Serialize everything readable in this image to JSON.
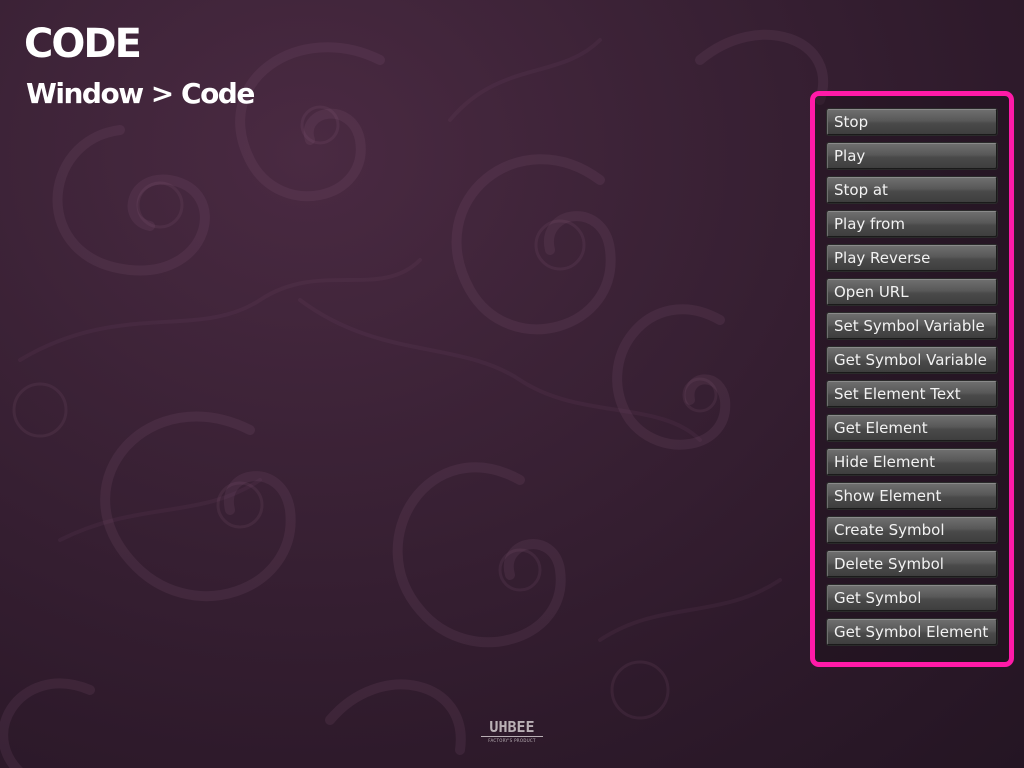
{
  "slide": {
    "title": "CODE",
    "subtitle": "Window > Code"
  },
  "code_panel": {
    "buttons": [
      {
        "label": "Stop"
      },
      {
        "label": "Play"
      },
      {
        "label": "Stop at"
      },
      {
        "label": "Play from"
      },
      {
        "label": "Play Reverse"
      },
      {
        "label": "Open URL"
      },
      {
        "label": "Set Symbol Variable"
      },
      {
        "label": "Get Symbol Variable"
      },
      {
        "label": "Set Element Text"
      },
      {
        "label": "Get Element"
      },
      {
        "label": "Hide Element"
      },
      {
        "label": "Show Element"
      },
      {
        "label": "Create Symbol"
      },
      {
        "label": "Delete Symbol"
      },
      {
        "label": "Get Symbol"
      },
      {
        "label": "Get Symbol Element"
      }
    ]
  },
  "logo": {
    "main": "UHBEE",
    "sub": "FACTORY'S PRODUCT"
  },
  "colors": {
    "highlight_border": "#ff1aa8",
    "background": "#3b2236",
    "text": "#ffffff"
  }
}
